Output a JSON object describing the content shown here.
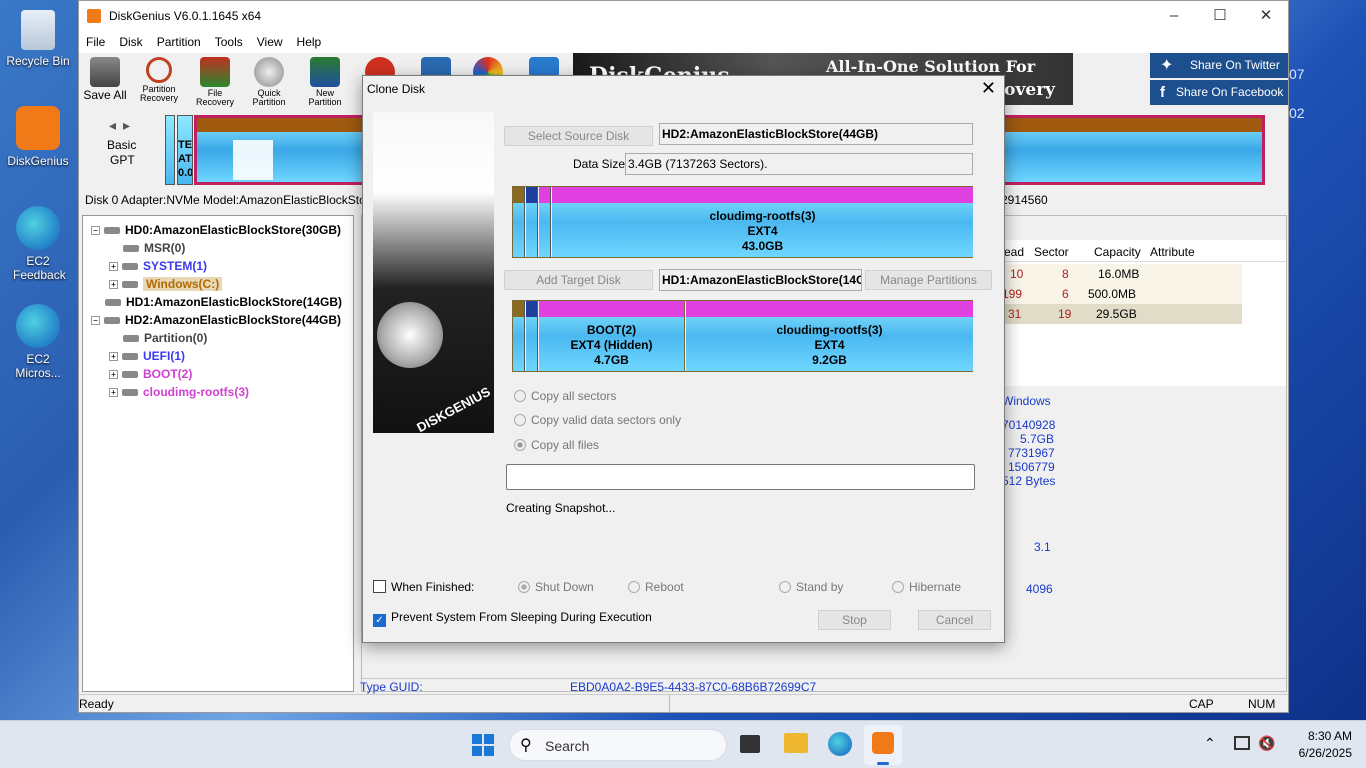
{
  "desktop": {
    "icons": [
      {
        "label": "Recycle Bin"
      },
      {
        "label": "DiskGenius"
      },
      {
        "label": "EC2 Feedback"
      },
      {
        "label": "EC2 Micros..."
      }
    ],
    "right_partial": [
      "07",
      "02"
    ]
  },
  "app": {
    "title": "DiskGenius V6.0.1.1645 x64",
    "menu": [
      "File",
      "Disk",
      "Partition",
      "Tools",
      "View",
      "Help"
    ],
    "toolbar": {
      "save_all": "Save All",
      "partition_recovery": "Partition Recovery",
      "file_recovery": "File Recovery",
      "quick_partition": "Quick Partition",
      "new_partition": "New Partition"
    },
    "banner": {
      "line1": "All-In-One Solution For",
      "line2": "ecovery",
      "brand": "DiskGenius"
    },
    "share_twitter": "Share On Twitter",
    "share_facebook": "Share On Facebook",
    "disk_nav": {
      "type1": "Basic",
      "type2": "GPT"
    },
    "disk_strip_labels": [
      "TEM",
      "AT3",
      "0.0"
    ],
    "disk_info": "Disk 0 Adapter:NVMe  Model:AmazonElasticBlockSto",
    "disk_info_right": "2914560",
    "tree": [
      {
        "label": "HD0:AmazonElasticBlockStore(30GB)",
        "color": "#000000"
      },
      {
        "label": "MSR(0)",
        "color": "#333333"
      },
      {
        "label": "SYSTEM(1)",
        "color": "#3a3af0"
      },
      {
        "label": "Windows(C:)",
        "color": "#b06a00"
      },
      {
        "label": "HD1:AmazonElasticBlockStore(14GB)",
        "color": "#000000"
      },
      {
        "label": "HD2:AmazonElasticBlockStore(44GB)",
        "color": "#000000"
      },
      {
        "label": "Partition(0)",
        "color": "#333333"
      },
      {
        "label": "UEFI(1)",
        "color": "#3a3af0"
      },
      {
        "label": "BOOT(2)",
        "color": "#d040d0"
      },
      {
        "label": "cloudimg-rootfs(3)",
        "color": "#d040d0"
      }
    ],
    "table": {
      "headers": [
        "ead",
        "Sector",
        "Capacity",
        "Attribute"
      ],
      "rows": [
        [
          "10",
          "8",
          "16.0MB",
          ""
        ],
        [
          "199",
          "6",
          "500.0MB",
          ""
        ],
        [
          "31",
          "19",
          "29.5GB",
          ""
        ]
      ]
    },
    "details": {
      "fs": "Windows",
      "vals": [
        "70140928",
        "5.7GB",
        "7731967",
        "1506779",
        "512 Bytes"
      ],
      "ver": "3.1",
      "cluster": "4096"
    },
    "type_guid_label": "Type GUID:",
    "type_guid_value": "EBD0A0A2-B9E5-4433-87C0-68B6B72699C7",
    "status": {
      "left": "Ready",
      "cap": "CAP",
      "num": "NUM"
    }
  },
  "dialog": {
    "title": "Clone Disk",
    "select_source": "Select Source Disk",
    "source_disk": "HD2:AmazonElasticBlockStore(44GB)",
    "data_size_label": "Data Size:",
    "data_size_value": "3.4GB (7137263 Sectors).",
    "source_partition": {
      "name": "cloudimg-rootfs(3)",
      "fs": "EXT4",
      "size": "43.0GB"
    },
    "add_target": "Add Target Disk",
    "target_disk": "HD1:AmazonElasticBlockStore(14GI",
    "manage_partitions": "Manage Partitions",
    "target_partitions": [
      {
        "name": "BOOT(2)",
        "fs": "EXT4 (Hidden)",
        "size": "4.7GB"
      },
      {
        "name": "cloudimg-rootfs(3)",
        "fs": "EXT4",
        "size": "9.2GB"
      }
    ],
    "options": [
      "Copy all sectors",
      "Copy valid data sectors only",
      "Copy all files"
    ],
    "progress_fraction": 0.0,
    "status": "Creating Snapshot...",
    "when_finished": "When Finished:",
    "finish_options": [
      "Shut Down",
      "Reboot",
      "Stand by",
      "Hibernate"
    ],
    "prevent_sleep": "Prevent System From Sleeping During Execution",
    "stop": "Stop",
    "cancel": "Cancel",
    "side_brand": "DISKGENIUS"
  },
  "taskbar": {
    "search": "Search",
    "time": "8:30 AM",
    "date": "6/26/2025"
  },
  "colors": {
    "accent": "#e040e0",
    "partition_blue": "#4ab8f0",
    "link_blue": "#1a3acb"
  }
}
